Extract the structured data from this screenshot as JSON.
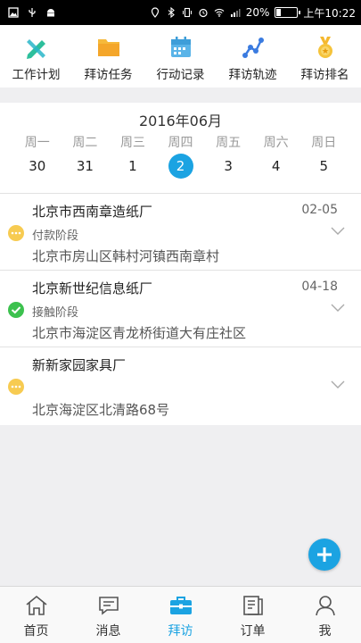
{
  "status_bar": {
    "battery": "20%",
    "time": "上午10:22",
    "battery_level": 0.2
  },
  "toolbar": {
    "items": [
      {
        "label": "工作计划",
        "icon": "pen-ruler-icon"
      },
      {
        "label": "拜访任务",
        "icon": "folder-icon"
      },
      {
        "label": "行动记录",
        "icon": "calendar-icon"
      },
      {
        "label": "拜访轨迹",
        "icon": "route-icon"
      },
      {
        "label": "拜访排名",
        "icon": "medal-icon"
      }
    ]
  },
  "calendar": {
    "month": "2016年06月",
    "weekdays": [
      "周一",
      "周二",
      "周三",
      "周四",
      "周五",
      "周六",
      "周日"
    ],
    "dates": [
      "30",
      "31",
      "1",
      "2",
      "3",
      "4",
      "5"
    ],
    "selected": "2"
  },
  "visits": [
    {
      "name": "北京市西南章造纸厂",
      "date": "02-05",
      "stage": "付款阶段",
      "address": "北京市房山区韩村河镇西南章村",
      "status": "pending"
    },
    {
      "name": "北京新世纪信息纸厂",
      "date": "04-18",
      "stage": "接触阶段",
      "address": "北京市海淀区青龙桥街道大有庄社区",
      "status": "done"
    },
    {
      "name": "新新家园家具厂",
      "date": "",
      "stage": "",
      "address": "北京海淀区北清路68号",
      "status": "pending"
    }
  ],
  "bottom_nav": {
    "active": "拜访",
    "items": [
      {
        "label": "首页",
        "icon": "home-icon"
      },
      {
        "label": "消息",
        "icon": "message-icon"
      },
      {
        "label": "拜访",
        "icon": "briefcase-icon"
      },
      {
        "label": "订单",
        "icon": "orders-icon"
      },
      {
        "label": "我",
        "icon": "user-icon"
      }
    ]
  },
  "colors": {
    "accent": "#1ba3e2",
    "pending": "#f7cb51",
    "done": "#3cc14e"
  }
}
